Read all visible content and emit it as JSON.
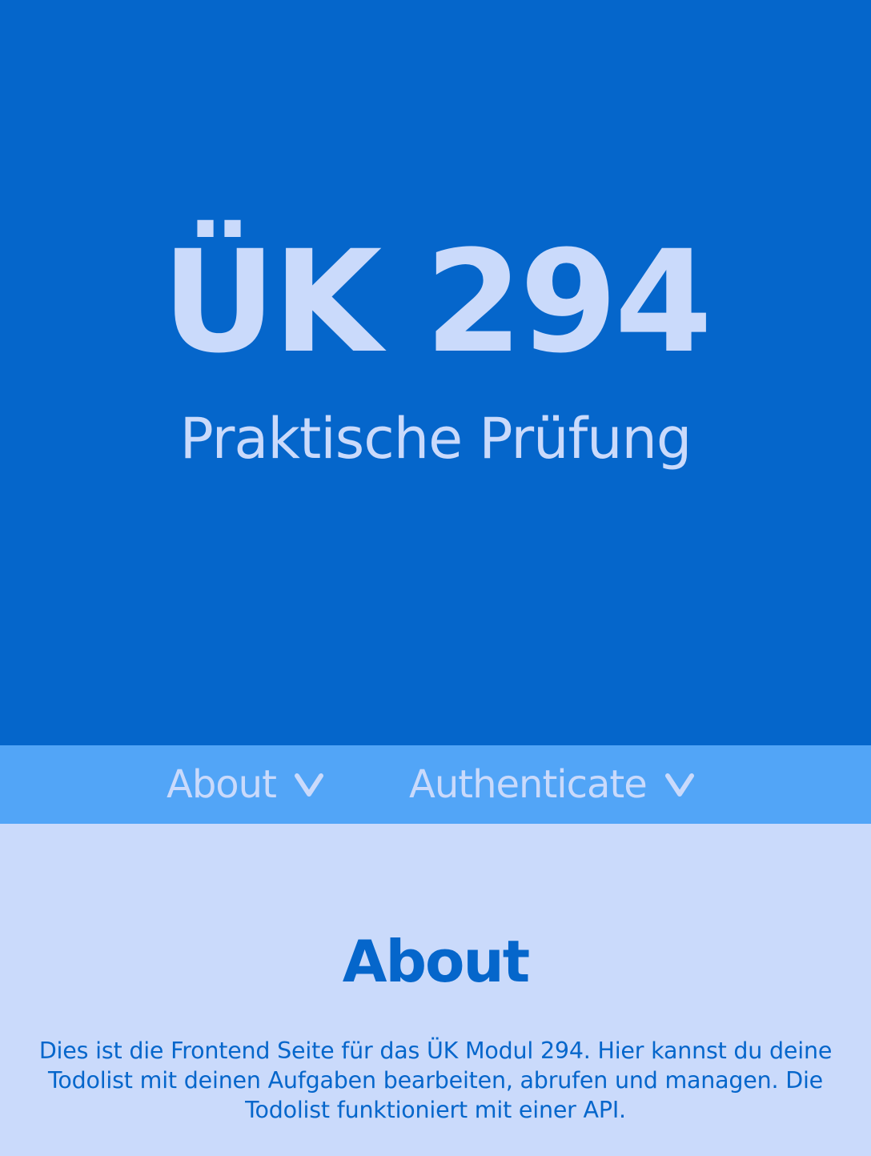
{
  "hero": {
    "title": "ÜK 294",
    "subtitle": "Praktische Prüfung"
  },
  "nav": {
    "items": [
      {
        "label": "About",
        "icon": "chevron-down-icon"
      },
      {
        "label": "Authenticate",
        "icon": "chevron-down-icon"
      }
    ]
  },
  "about": {
    "heading": "About",
    "text": "Dies ist die Frontend Seite für das ÜK Modul 294. Hier kannst du deine Todolist mit deinen Aufgaben bearbeiten, abrufen und managen. Die Todolist funktioniert mit einer API."
  },
  "colors": {
    "hero_bg": "#0566cb",
    "nav_bg": "#52a5f7",
    "content_bg": "#cadafb",
    "light_text": "#cadafb",
    "dark_text": "#0566cb"
  }
}
